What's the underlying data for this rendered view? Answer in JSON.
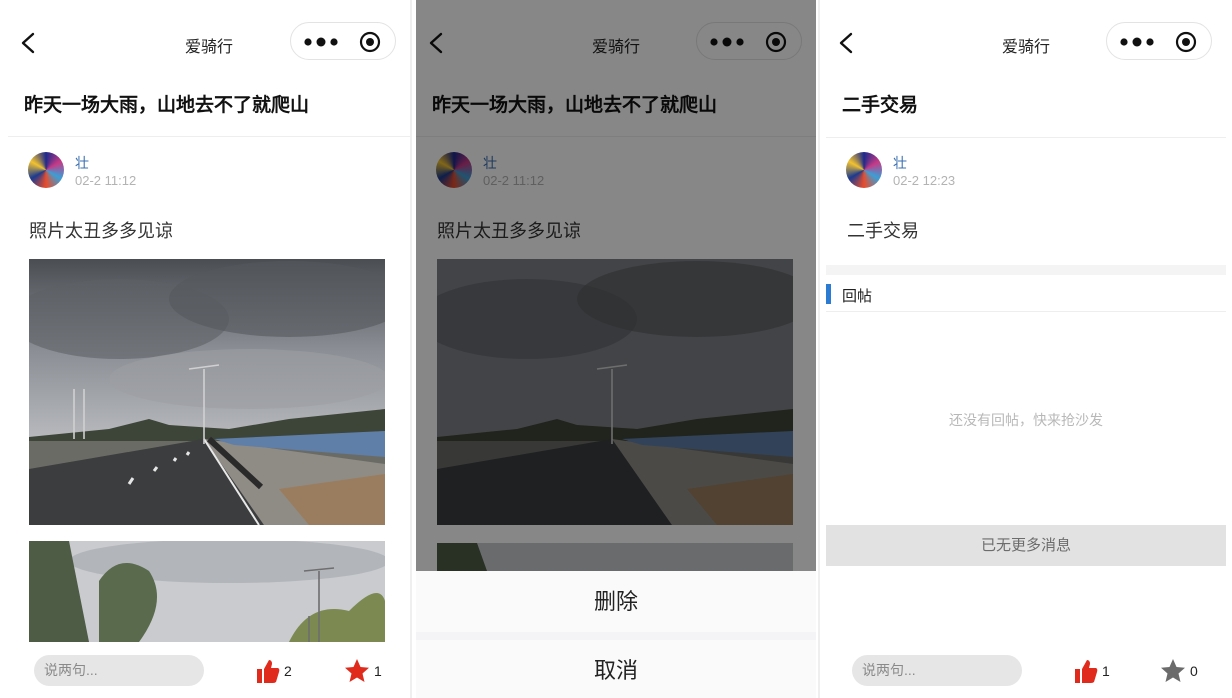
{
  "nav": {
    "title": "爱骑行"
  },
  "screens": [
    {
      "post_title": "昨天一场大雨，山地去不了就爬山",
      "author": "壮",
      "time": "02-2 11:12",
      "content": "照片太丑多多见谅",
      "input_placeholder": "说两句...",
      "likes": "2",
      "favorites": "1",
      "like_icon_color": "#e02a1c",
      "favorite_icon_color": "#e02a1c"
    },
    {
      "post_title": "昨天一场大雨，山地去不了就爬山",
      "author": "壮",
      "time": "02-2 11:12",
      "content": "照片太丑多多见谅",
      "action_sheet": {
        "delete_label": "删除",
        "cancel_label": "取消"
      }
    },
    {
      "post_title": "二手交易",
      "author": "壮",
      "time": "02-2 12:23",
      "content": "二手交易",
      "replies_heading": "回帖",
      "empty_replies": "还没有回帖，快来抢沙发",
      "no_more": "已无更多消息",
      "input_placeholder": "说两句...",
      "likes": "1",
      "favorites": "0",
      "like_icon_color": "#e02a1c",
      "favorite_icon_color": "#6b6b6b"
    }
  ]
}
